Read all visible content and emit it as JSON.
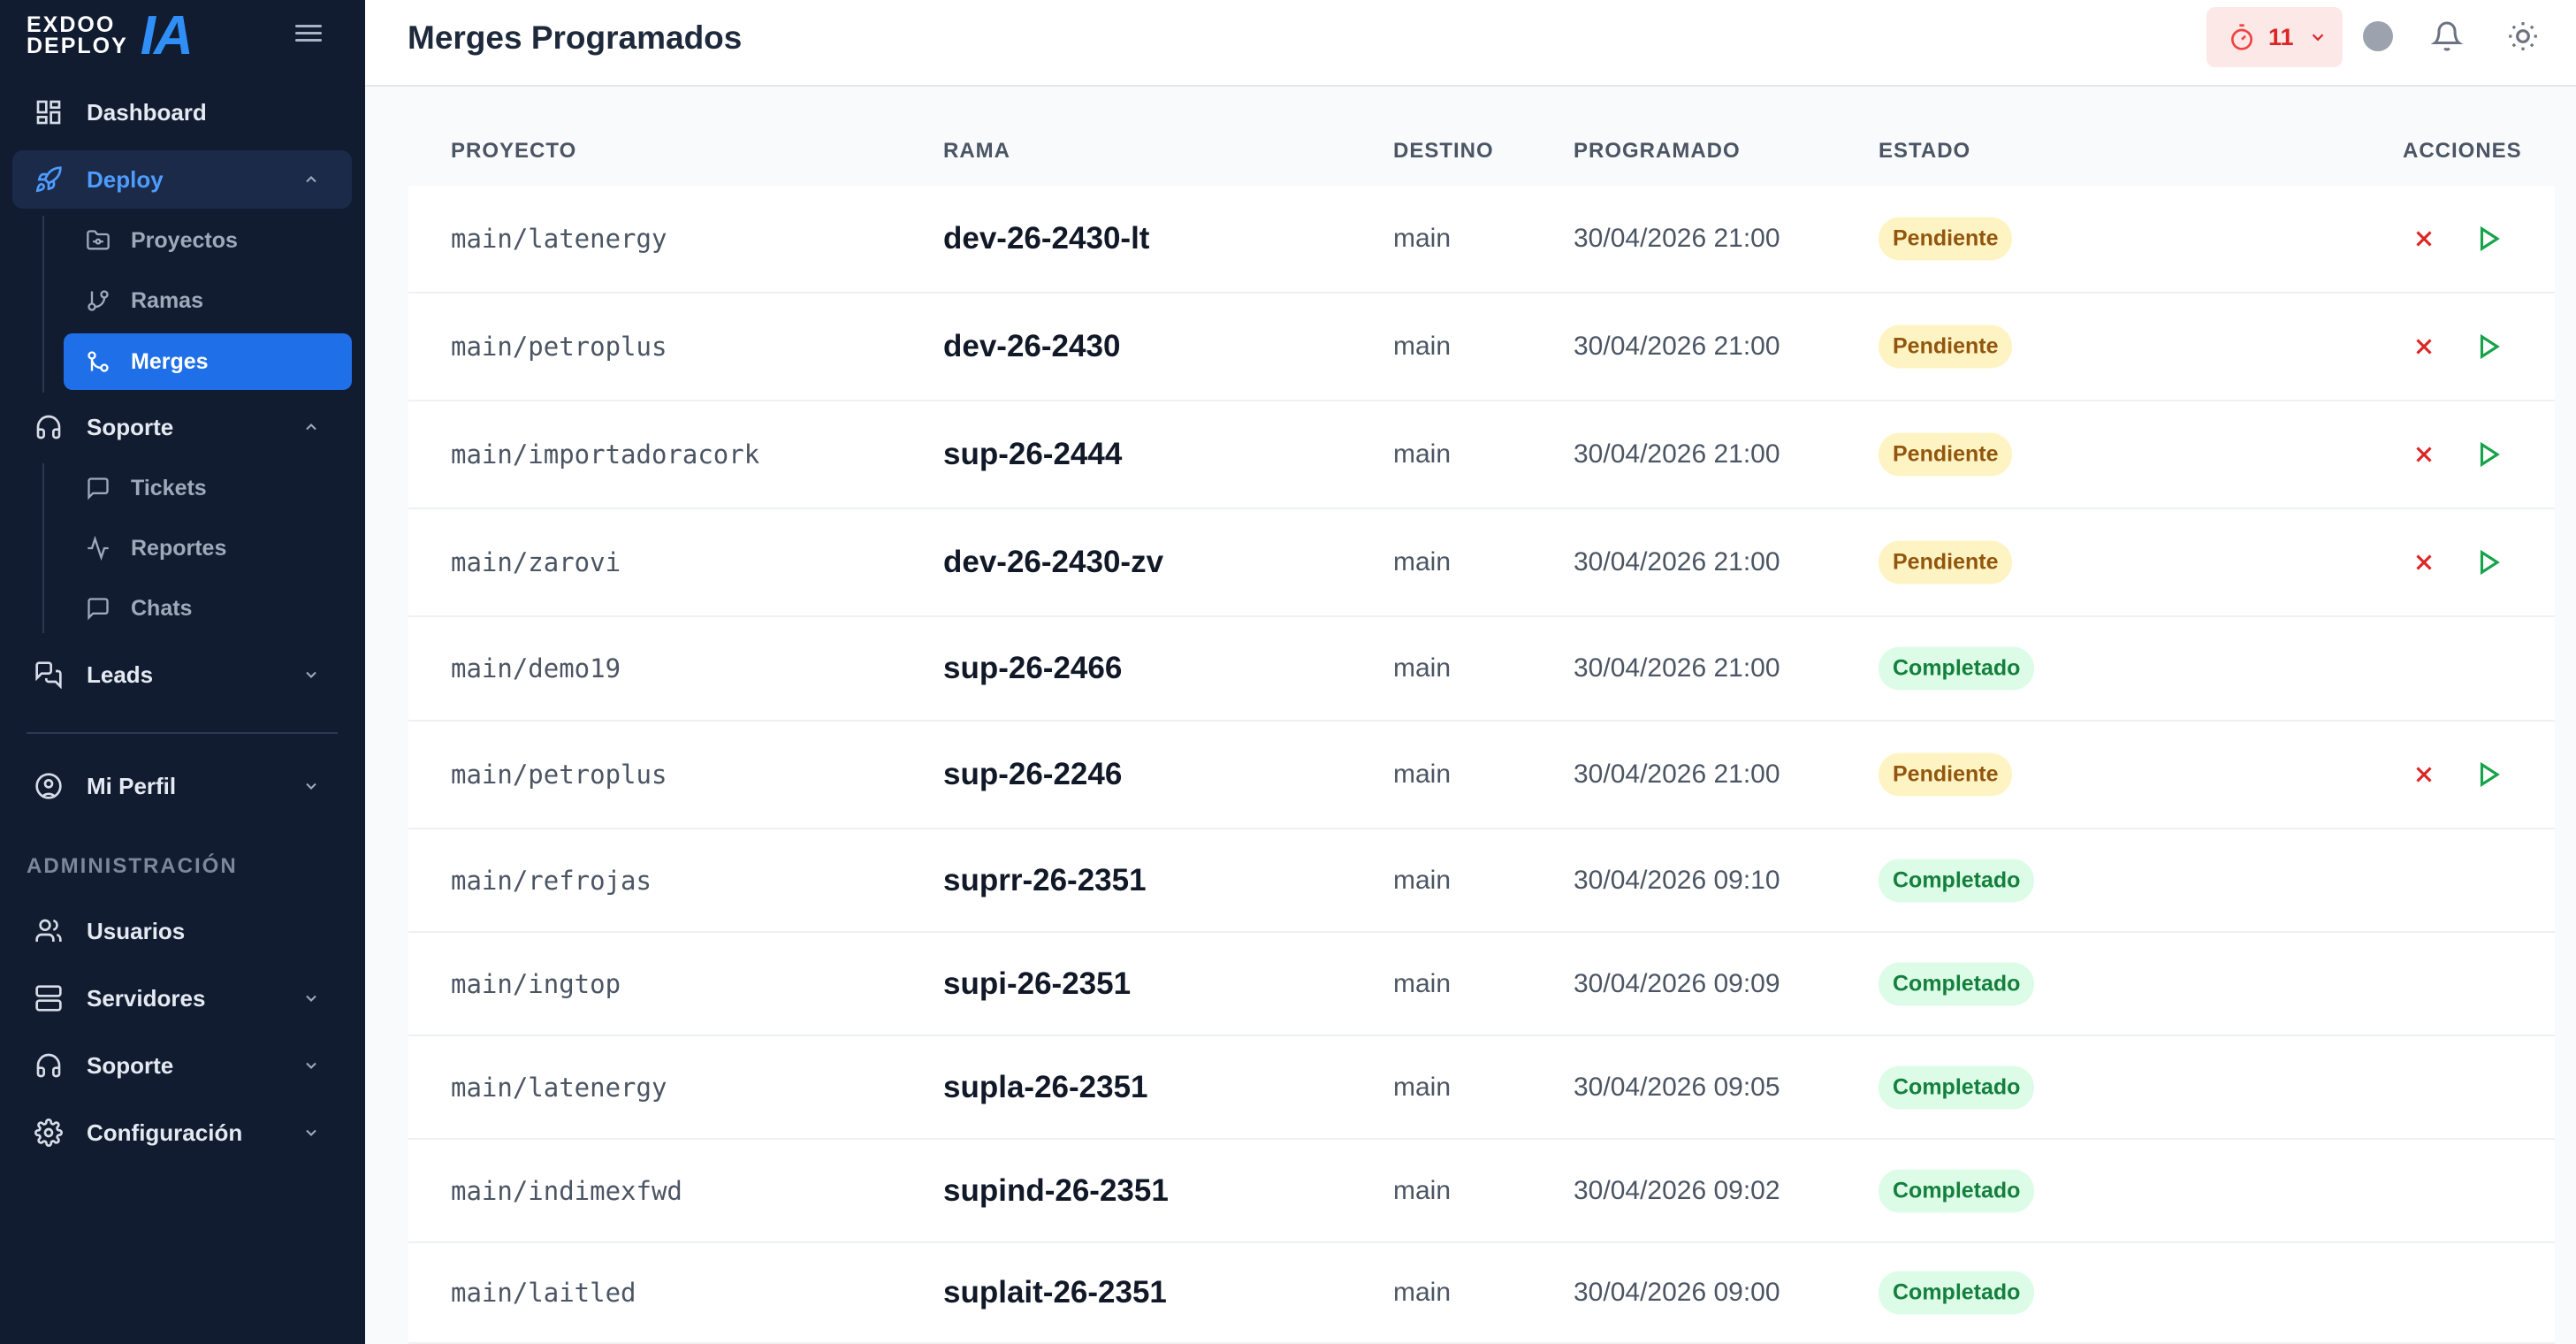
{
  "brand": {
    "line1": "EXDOO",
    "line2": "DEPLOY",
    "mark": "IA"
  },
  "header": {
    "title": "Merges Programados",
    "timer_count": "11"
  },
  "sidebar": {
    "dashboard": "Dashboard",
    "deploy": "Deploy",
    "deploy_items": [
      "Proyectos",
      "Ramas",
      "Merges"
    ],
    "soporte": "Soporte",
    "soporte_items": [
      "Tickets",
      "Reportes",
      "Chats"
    ],
    "leads": "Leads",
    "perfil": "Mi Perfil",
    "admin_title": "ADMINISTRACIÓN",
    "usuarios": "Usuarios",
    "servidores": "Servidores",
    "soporte2": "Soporte",
    "configuracion": "Configuración"
  },
  "table": {
    "headers": {
      "proyecto": "PROYECTO",
      "rama": "RAMA",
      "destino": "DESTINO",
      "programado": "PROGRAMADO",
      "estado": "ESTADO",
      "acciones": "ACCIONES"
    },
    "rows": [
      {
        "proyecto": "main/latenergy",
        "rama": "dev-26-2430-lt",
        "destino": "main",
        "programado": "30/04/2026 21:00",
        "estado": "Pendiente"
      },
      {
        "proyecto": "main/petroplus",
        "rama": "dev-26-2430",
        "destino": "main",
        "programado": "30/04/2026 21:00",
        "estado": "Pendiente"
      },
      {
        "proyecto": "main/importadoracork",
        "rama": "sup-26-2444",
        "destino": "main",
        "programado": "30/04/2026 21:00",
        "estado": "Pendiente"
      },
      {
        "proyecto": "main/zarovi",
        "rama": "dev-26-2430-zv",
        "destino": "main",
        "programado": "30/04/2026 21:00",
        "estado": "Pendiente"
      },
      {
        "proyecto": "main/demo19",
        "rama": "sup-26-2466",
        "destino": "main",
        "programado": "30/04/2026 21:00",
        "estado": "Completado"
      },
      {
        "proyecto": "main/petroplus",
        "rama": "sup-26-2246",
        "destino": "main",
        "programado": "30/04/2026 21:00",
        "estado": "Pendiente"
      },
      {
        "proyecto": "main/refrojas",
        "rama": "suprr-26-2351",
        "destino": "main",
        "programado": "30/04/2026 09:10",
        "estado": "Completado"
      },
      {
        "proyecto": "main/ingtop",
        "rama": "supi-26-2351",
        "destino": "main",
        "programado": "30/04/2026 09:09",
        "estado": "Completado"
      },
      {
        "proyecto": "main/latenergy",
        "rama": "supla-26-2351",
        "destino": "main",
        "programado": "30/04/2026 09:05",
        "estado": "Completado"
      },
      {
        "proyecto": "main/indimexfwd",
        "rama": "supind-26-2351",
        "destino": "main",
        "programado": "30/04/2026 09:02",
        "estado": "Completado"
      },
      {
        "proyecto": "main/laitled",
        "rama": "suplait-26-2351",
        "destino": "main",
        "programado": "30/04/2026 09:00",
        "estado": "Completado"
      }
    ]
  },
  "colors": {
    "sidebar_bg": "#111c31",
    "accent": "#1f70e8",
    "pending_bg": "#fef4c3",
    "completed_bg": "#dcfce7",
    "cancel": "#dc2626",
    "run": "#16a34a"
  }
}
